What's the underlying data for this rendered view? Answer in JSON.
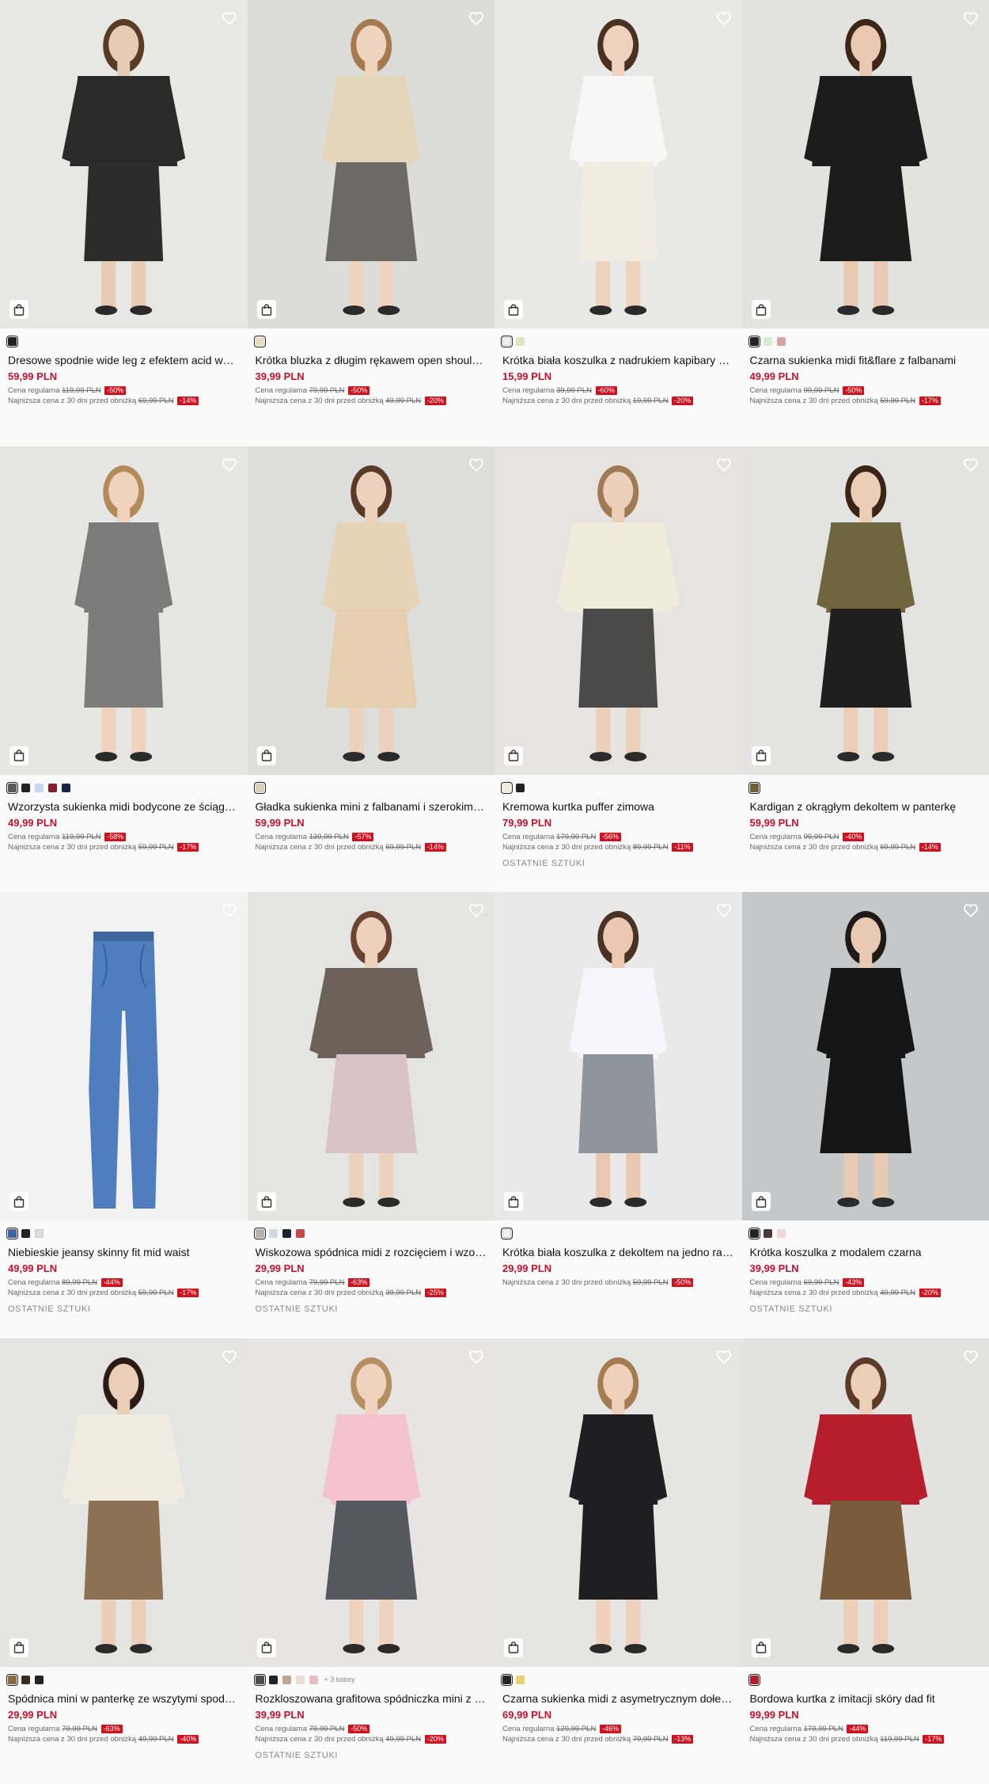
{
  "labels": {
    "regular": "Cena regularna",
    "lowest": "Najniższa cena z 30 dni przed obniżką"
  },
  "products": [
    {
      "name": "Dresowe spodnie wide leg z efektem acid wash",
      "price": "59,99 PLN",
      "regular_price": "119,99 PLN",
      "regular_discount": "-50%",
      "lowest_price": "69,99 PLN",
      "lowest_discount": "-14%",
      "colors": [
        "#222222"
      ],
      "selected": 0,
      "more_colors": "",
      "last_units": "",
      "bg": "#e7e7e5",
      "top": "#2a2a2a",
      "bottom": "#2c2c2c",
      "hair": "#5a3b26",
      "skin": "#e8cbb5"
    },
    {
      "name": "Krótka bluzka z długim rękawem open shoulder",
      "price": "39,99 PLN",
      "regular_price": "79,99 PLN",
      "regular_discount": "-50%",
      "lowest_price": "49,99 PLN",
      "lowest_discount": "-20%",
      "colors": [
        "#e9dcc4"
      ],
      "selected": 0,
      "more_colors": "",
      "last_units": "",
      "bg": "#dcdcd8",
      "top": "#e4d6bb",
      "bottom": "#6d6a66",
      "hair": "#a57a4e",
      "skin": "#efd4bf"
    },
    {
      "name": "Krótka biała koszulka z nadrukiem kapibary ze stopkami",
      "price": "15,99 PLN",
      "regular_price": "39,99 PLN",
      "regular_discount": "-60%",
      "lowest_price": "19,99 PLN",
      "lowest_discount": "-20%",
      "colors": [
        "#f0f0f0",
        "#dfe7c0"
      ],
      "selected": 0,
      "more_colors": "",
      "last_units": "",
      "bg": "#e8e8e6",
      "top": "#f7f7f7",
      "bottom": "#f1ece2",
      "hair": "#4a3020",
      "skin": "#efd2bd"
    },
    {
      "name": "Czarna sukienka midi fit&flare z falbanami",
      "price": "49,99 PLN",
      "regular_price": "99,99 PLN",
      "regular_discount": "-50%",
      "lowest_price": "59,99 PLN",
      "lowest_discount": "-17%",
      "colors": [
        "#222222",
        "#dbe9d9",
        "#d9a4a7"
      ],
      "selected": 0,
      "more_colors": "",
      "last_units": "",
      "bg": "#e2e2de",
      "top": "#1c1c1c",
      "bottom": "#1c1c1c",
      "hair": "#3b2618",
      "skin": "#e9c9b1"
    },
    {
      "name": "Wzorzysta sukienka midi bodycone ze ściągaczem",
      "price": "49,99 PLN",
      "regular_price": "119,99 PLN",
      "regular_discount": "-58%",
      "lowest_price": "59,99 PLN",
      "lowest_discount": "-17%",
      "colors": [
        "#5a5a5a",
        "#222222",
        "#c7d6ec",
        "#8a1c2a",
        "#1c2348"
      ],
      "selected": 0,
      "more_colors": "",
      "last_units": "",
      "bg": "#e6e6e4",
      "top": "#7b7b7b",
      "bottom": "#7b7b7b",
      "hair": "#b58a59",
      "skin": "#efd3bf"
    },
    {
      "name": "Gładka sukienka mini z falbanami i szerokimi rękawami",
      "price": "59,99 PLN",
      "regular_price": "139,99 PLN",
      "regular_discount": "-57%",
      "lowest_price": "69,99 PLN",
      "lowest_discount": "-14%",
      "colors": [
        "#d9d1b5"
      ],
      "selected": 0,
      "more_colors": "",
      "last_units": "",
      "bg": "#dddddb",
      "top": "#e7d4b6",
      "bottom": "#e5cfae",
      "hair": "#5b3a28",
      "skin": "#edd1bc"
    },
    {
      "name": "Kremowa kurtka puffer zimowa",
      "price": "79,99 PLN",
      "regular_price": "179,99 PLN",
      "regular_discount": "-56%",
      "lowest_price": "89,99 PLN",
      "lowest_discount": "-11%",
      "colors": [
        "#eeeadc",
        "#222222"
      ],
      "selected": 0,
      "more_colors": "",
      "last_units": "OSTATNIE SZTUKI",
      "bg": "#e5e4e1",
      "top": "#f0ebdb",
      "bottom": "#4a4a4a",
      "hair": "#a07a55",
      "skin": "#eccfb9"
    },
    {
      "name": "Kardigan z okrągłym dekoltem w panterkę",
      "price": "59,99 PLN",
      "regular_price": "99,99 PLN",
      "regular_discount": "-40%",
      "lowest_price": "69,99 PLN",
      "lowest_discount": "-14%",
      "colors": [
        "#6b6038"
      ],
      "selected": 0,
      "more_colors": "",
      "last_units": "",
      "bg": "#e3e3e1",
      "top": "#6f6640",
      "bottom": "#1f1f1f",
      "hair": "#3a2416",
      "skin": "#ecceb7"
    },
    {
      "name": "Niebieskie jeansy skinny fit mid waist",
      "price": "49,99 PLN",
      "regular_price": "89,99 PLN",
      "regular_discount": "-44%",
      "lowest_price": "59,99 PLN",
      "lowest_discount": "-17%",
      "colors": [
        "#3e63a7",
        "#222222",
        "#dddddd"
      ],
      "selected": 0,
      "more_colors": "",
      "last_units": "OSTATNIE SZTUKI",
      "bg": "#f2f2f2",
      "top": "#4f7dbd",
      "bottom": "#4f7dbd",
      "hair": "",
      "skin": ""
    },
    {
      "name": "Wiskozowa spódnica midi z rozcięciem i wzorem",
      "price": "29,99 PLN",
      "regular_price": "79,99 PLN",
      "regular_discount": "-63%",
      "lowest_price": "39,99 PLN",
      "lowest_discount": "-25%",
      "colors": [
        "#b9aeb0",
        "#d6d6de",
        "#1c2330",
        "#c7484b"
      ],
      "selected": 0,
      "more_colors": "",
      "last_units": "OSTATNIE SZTUKI",
      "bg": "#e4e4e2",
      "top": "#6d6259",
      "bottom": "#d9c3c8",
      "hair": "#6a4430",
      "skin": "#edd1bc"
    },
    {
      "name": "Krótka biała koszulka z dekoltem na jedno ramię",
      "price": "29,99 PLN",
      "regular_price": "",
      "regular_discount": "",
      "lowest_price": "59,99 PLN",
      "lowest_discount": "-50%",
      "colors": [
        "#f2f2f2"
      ],
      "selected": 0,
      "more_colors": "",
      "last_units": "",
      "bg": "#e9e9e9",
      "top": "#f5f5fb",
      "bottom": "#8f959c",
      "hair": "#4a3224",
      "skin": "#e9c7b0"
    },
    {
      "name": "Krótka koszulka z modalem czarna",
      "price": "39,99 PLN",
      "regular_price": "69,99 PLN",
      "regular_discount": "-43%",
      "lowest_price": "49,99 PLN",
      "lowest_discount": "-20%",
      "colors": [
        "#222222",
        "#4a3a3a",
        "#f4d4dd"
      ],
      "selected": 0,
      "more_colors": "",
      "last_units": "OSTATNIE SZTUKI",
      "bg": "#c6c7c9",
      "top": "#151515",
      "bottom": "#151515",
      "hair": "#1f1a17",
      "skin": "#e8c9b1"
    },
    {
      "name": "Spódnica mini w panterkę ze wszytymi spodenkami",
      "price": "29,99 PLN",
      "regular_price": "79,99 PLN",
      "regular_discount": "-63%",
      "lowest_price": "49,99 PLN",
      "lowest_discount": "-40%",
      "colors": [
        "#8b6a40",
        "#3a2a22",
        "#222222"
      ],
      "selected": 0,
      "more_colors": "",
      "last_units": "",
      "bg": "#e4e4e2",
      "top": "#f0ece2",
      "bottom": "#8c7152",
      "hair": "#2a1c14",
      "skin": "#ecceb8"
    },
    {
      "name": "Rozkloszowana grafitowa spódniczka mini z szortami",
      "price": "39,99 PLN",
      "regular_price": "79,99 PLN",
      "regular_discount": "-50%",
      "lowest_price": "49,99 PLN",
      "lowest_discount": "-20%",
      "colors": [
        "#4b4d55",
        "#222222",
        "#bfa58f",
        "#e4e0d8",
        "#e8bcc0"
      ],
      "selected": 0,
      "more_colors": "+ 3 kolory",
      "last_units": "OSTATNIE SZTUKI",
      "bg": "#e6e5e3",
      "top": "#f4c2cf",
      "bottom": "#55585f",
      "hair": "#b58e62",
      "skin": "#efd3bf"
    },
    {
      "name": "Czarna sukienka midi z asymetrycznym dołem w kropki",
      "price": "69,99 PLN",
      "regular_price": "129,99 PLN",
      "regular_discount": "-46%",
      "lowest_price": "79,99 PLN",
      "lowest_discount": "-13%",
      "colors": [
        "#222222",
        "#e8d26d"
      ],
      "selected": 0,
      "more_colors": "",
      "last_units": "",
      "bg": "#e5e5e3",
      "top": "#1f1f22",
      "bottom": "#1f1f22",
      "hair": "#a57b50",
      "skin": "#efd1bb"
    },
    {
      "name": "Bordowa kurtka z imitacji skóry dad fit",
      "price": "99,99 PLN",
      "regular_price": "179,99 PLN",
      "regular_discount": "-44%",
      "lowest_price": "119,99 PLN",
      "lowest_discount": "-17%",
      "colors": [
        "#b01f2c"
      ],
      "selected": 0,
      "more_colors": "",
      "last_units": "",
      "bg": "#e2e2e0",
      "top": "#b51e2a",
      "bottom": "#7a5c3c",
      "hair": "#5b3a27",
      "skin": "#ecceb9"
    }
  ]
}
